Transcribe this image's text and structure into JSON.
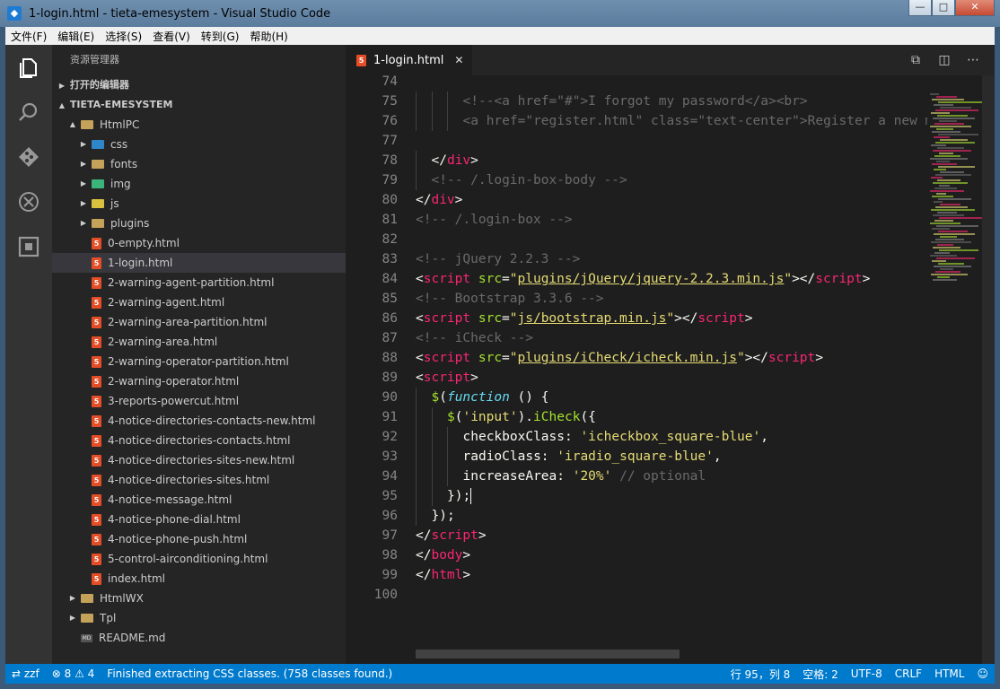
{
  "window": {
    "title": "1-login.html - tieta-emesystem - Visual Studio Code",
    "minimize": "—",
    "maximize": "□",
    "close": "✕"
  },
  "menu": [
    "文件(F)",
    "编辑(E)",
    "选择(S)",
    "查看(V)",
    "转到(G)",
    "帮助(H)"
  ],
  "activity": [
    "explorer-icon",
    "search-icon",
    "git-icon",
    "debug-icon",
    "extensions-icon"
  ],
  "sidebar": {
    "title": "资源管理器",
    "open_editors": "打开的编辑器",
    "project": "TIETA-EMESYSTEM",
    "tree": [
      {
        "label": "HtmlPC",
        "kind": "folder",
        "depth": 1,
        "arrow": "▲"
      },
      {
        "label": "css",
        "kind": "folder",
        "depth": 2,
        "arrow": "▶",
        "color": "#2f86c9"
      },
      {
        "label": "fonts",
        "kind": "folder",
        "depth": 2,
        "arrow": "▶",
        "color": "#c5a25a"
      },
      {
        "label": "img",
        "kind": "folder",
        "depth": 2,
        "arrow": "▶",
        "color": "#3bb57a"
      },
      {
        "label": "js",
        "kind": "folder",
        "depth": 2,
        "arrow": "▶",
        "color": "#d9c03e"
      },
      {
        "label": "plugins",
        "kind": "folder",
        "depth": 2,
        "arrow": "▶",
        "color": "#c5a25a"
      },
      {
        "label": "0-empty.html",
        "kind": "html",
        "depth": 2
      },
      {
        "label": "1-login.html",
        "kind": "html",
        "depth": 2,
        "selected": true
      },
      {
        "label": "2-warning-agent-partition.html",
        "kind": "html",
        "depth": 2
      },
      {
        "label": "2-warning-agent.html",
        "kind": "html",
        "depth": 2
      },
      {
        "label": "2-warning-area-partition.html",
        "kind": "html",
        "depth": 2
      },
      {
        "label": "2-warning-area.html",
        "kind": "html",
        "depth": 2
      },
      {
        "label": "2-warning-operator-partition.html",
        "kind": "html",
        "depth": 2
      },
      {
        "label": "2-warning-operator.html",
        "kind": "html",
        "depth": 2
      },
      {
        "label": "3-reports-powercut.html",
        "kind": "html",
        "depth": 2
      },
      {
        "label": "4-notice-directories-contacts-new.html",
        "kind": "html",
        "depth": 2
      },
      {
        "label": "4-notice-directories-contacts.html",
        "kind": "html",
        "depth": 2
      },
      {
        "label": "4-notice-directories-sites-new.html",
        "kind": "html",
        "depth": 2
      },
      {
        "label": "4-notice-directories-sites.html",
        "kind": "html",
        "depth": 2
      },
      {
        "label": "4-notice-message.html",
        "kind": "html",
        "depth": 2
      },
      {
        "label": "4-notice-phone-dial.html",
        "kind": "html",
        "depth": 2
      },
      {
        "label": "4-notice-phone-push.html",
        "kind": "html",
        "depth": 2
      },
      {
        "label": "5-control-airconditioning.html",
        "kind": "html",
        "depth": 2
      },
      {
        "label": "index.html",
        "kind": "html",
        "depth": 2
      },
      {
        "label": "HtmlWX",
        "kind": "folder",
        "depth": 1,
        "arrow": "▶",
        "color": "#c5a25a"
      },
      {
        "label": "Tpl",
        "kind": "folder",
        "depth": 1,
        "arrow": "▶",
        "color": "#c5a25a"
      },
      {
        "label": "README.md",
        "kind": "md",
        "depth": 1
      }
    ]
  },
  "editor": {
    "tab_label": "1-login.html",
    "tab_close": "✕",
    "lines": [
      {
        "n": "74",
        "i": 0,
        "t": []
      },
      {
        "n": "75",
        "i": 3,
        "t": [
          [
            "cm",
            "<!--<a href=\"#\">I forgot my password</a><br>"
          ]
        ]
      },
      {
        "n": "76",
        "i": 3,
        "t": [
          [
            "cm",
            "<a href=\"register.html\" class=\"text-center\">Register a new membership</a>"
          ]
        ]
      },
      {
        "n": "77",
        "i": 0,
        "t": []
      },
      {
        "n": "78",
        "i": 1,
        "t": [
          [
            "br",
            "</"
          ],
          [
            "tag",
            "div"
          ],
          [
            "br",
            ">"
          ]
        ]
      },
      {
        "n": "79",
        "i": 1,
        "t": [
          [
            "cm",
            "<!-- /.login-box-body -->"
          ]
        ]
      },
      {
        "n": "80",
        "i": 0,
        "t": [
          [
            "br",
            "</"
          ],
          [
            "tag",
            "div"
          ],
          [
            "br",
            ">"
          ]
        ]
      },
      {
        "n": "81",
        "i": 0,
        "t": [
          [
            "cm",
            "<!-- /.login-box -->"
          ]
        ]
      },
      {
        "n": "82",
        "i": 0,
        "t": []
      },
      {
        "n": "83",
        "i": 0,
        "t": [
          [
            "cm",
            "<!-- jQuery 2.2.3 -->"
          ]
        ]
      },
      {
        "n": "84",
        "i": 0,
        "t": [
          [
            "br",
            "<"
          ],
          [
            "tag",
            "script"
          ],
          [
            "at",
            " src"
          ],
          [
            "br",
            "="
          ],
          [
            "st",
            "\""
          ],
          [
            "ul",
            "plugins/jQuery/jquery-2.2.3.min.js"
          ],
          [
            "st",
            "\""
          ],
          [
            "br",
            "></"
          ],
          [
            "tag",
            "script"
          ],
          [
            "br",
            ">"
          ]
        ]
      },
      {
        "n": "85",
        "i": 0,
        "t": [
          [
            "cm",
            "<!-- Bootstrap 3.3.6 -->"
          ]
        ]
      },
      {
        "n": "86",
        "i": 0,
        "t": [
          [
            "br",
            "<"
          ],
          [
            "tag",
            "script"
          ],
          [
            "at",
            " src"
          ],
          [
            "br",
            "="
          ],
          [
            "st",
            "\""
          ],
          [
            "ul",
            "js/bootstrap.min.js"
          ],
          [
            "st",
            "\""
          ],
          [
            "br",
            "></"
          ],
          [
            "tag",
            "script"
          ],
          [
            "br",
            ">"
          ]
        ]
      },
      {
        "n": "87",
        "i": 0,
        "t": [
          [
            "cm",
            "<!-- iCheck -->"
          ]
        ]
      },
      {
        "n": "88",
        "i": 0,
        "t": [
          [
            "br",
            "<"
          ],
          [
            "tag",
            "script"
          ],
          [
            "at",
            " src"
          ],
          [
            "br",
            "="
          ],
          [
            "st",
            "\""
          ],
          [
            "ul",
            "plugins/iCheck/icheck.min.js"
          ],
          [
            "st",
            "\""
          ],
          [
            "br",
            "></"
          ],
          [
            "tag",
            "script"
          ],
          [
            "br",
            ">"
          ]
        ]
      },
      {
        "n": "89",
        "i": 0,
        "t": [
          [
            "br",
            "<"
          ],
          [
            "tag",
            "script"
          ],
          [
            "br",
            ">"
          ]
        ]
      },
      {
        "n": "90",
        "i": 1,
        "t": [
          [
            "fn",
            "$"
          ],
          [
            "plain",
            "("
          ],
          [
            "kw",
            "function"
          ],
          [
            "plain",
            " () {"
          ]
        ]
      },
      {
        "n": "91",
        "i": 2,
        "t": [
          [
            "fn",
            "$"
          ],
          [
            "plain",
            "("
          ],
          [
            "st",
            "'input'"
          ],
          [
            "plain",
            ")."
          ],
          [
            "fn",
            "iCheck"
          ],
          [
            "plain",
            "({"
          ]
        ]
      },
      {
        "n": "92",
        "i": 3,
        "t": [
          [
            "plain",
            "checkboxClass: "
          ],
          [
            "st",
            "'icheckbox_square-blue'"
          ],
          [
            "plain",
            ","
          ]
        ]
      },
      {
        "n": "93",
        "i": 3,
        "t": [
          [
            "plain",
            "radioClass: "
          ],
          [
            "st",
            "'iradio_square-blue'"
          ],
          [
            "plain",
            ","
          ]
        ]
      },
      {
        "n": "94",
        "i": 3,
        "t": [
          [
            "plain",
            "increaseArea: "
          ],
          [
            "st",
            "'20%'"
          ],
          [
            "cm",
            " // optional"
          ]
        ]
      },
      {
        "n": "95",
        "i": 2,
        "t": [
          [
            "plain",
            "});"
          ]
        ],
        "cursor": true
      },
      {
        "n": "96",
        "i": 1,
        "t": [
          [
            "plain",
            "});"
          ]
        ]
      },
      {
        "n": "97",
        "i": 0,
        "t": [
          [
            "br",
            "</"
          ],
          [
            "tag",
            "script"
          ],
          [
            "br",
            ">"
          ]
        ]
      },
      {
        "n": "98",
        "i": 0,
        "t": [
          [
            "br",
            "</"
          ],
          [
            "tag",
            "body"
          ],
          [
            "br",
            ">"
          ]
        ]
      },
      {
        "n": "99",
        "i": 0,
        "t": [
          [
            "br",
            "</"
          ],
          [
            "tag",
            "html"
          ],
          [
            "br",
            ">"
          ]
        ]
      },
      {
        "n": "100",
        "i": 0,
        "t": []
      }
    ]
  },
  "statusbar": {
    "user": "zzf",
    "errors": "8",
    "warnings": "4",
    "message": "Finished extracting CSS classes. (758 classes found.)",
    "position": "行 95，列 8",
    "indent": "空格: 2",
    "encoding": "UTF-8",
    "eol": "CRLF",
    "language": "HTML",
    "feedback": "☺"
  },
  "colors": {
    "statusbar": "#007acc",
    "activitybar": "#333333",
    "editor_bg": "#1e1e1e",
    "sidebar_bg": "#252526"
  }
}
